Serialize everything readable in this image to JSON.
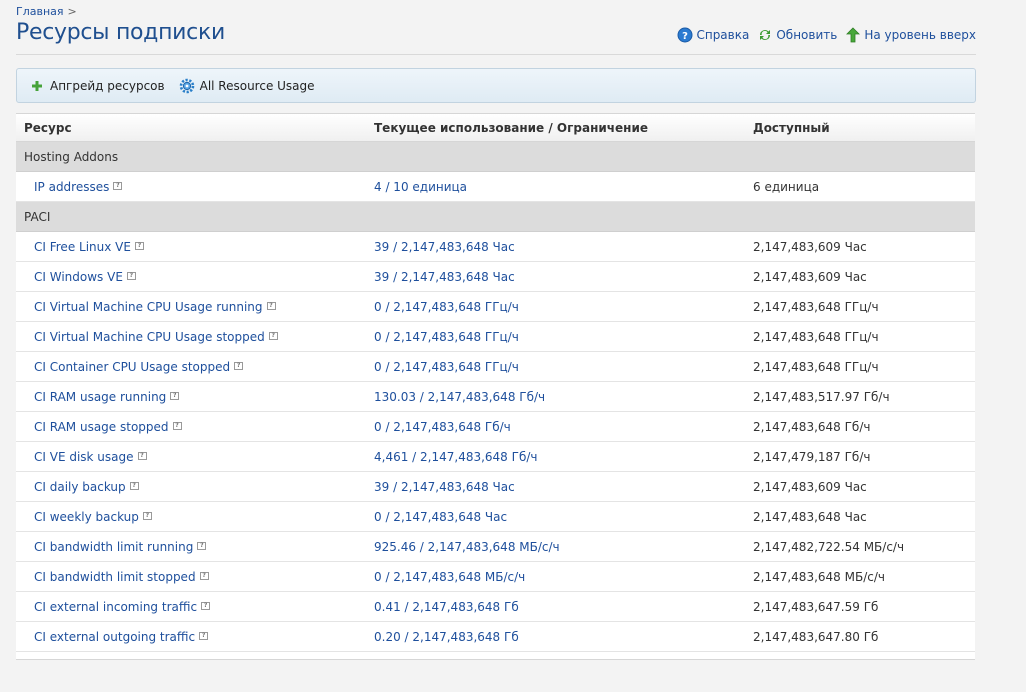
{
  "breadcrumb": {
    "home": "Главная",
    "separator": ">"
  },
  "page": {
    "title": "Ресурсы подписки"
  },
  "actions": {
    "help": "Справка",
    "refresh": "Обновить",
    "up_level": "На уровень вверх"
  },
  "toolbar": {
    "upgrade": "Апгрейд ресурсов",
    "all_usage": "All Resource Usage"
  },
  "table": {
    "headers": {
      "resource": "Ресурс",
      "usage": "Текущее использование / Ограничение",
      "available": "Доступный"
    },
    "groups": [
      {
        "name": "Hosting Addons",
        "rows": [
          {
            "name": "IP addresses",
            "usage": "4 / 10 единица",
            "available": "6 единица"
          }
        ]
      },
      {
        "name": "PACI",
        "rows": [
          {
            "name": "CI Free Linux VE",
            "usage": "39 / 2,147,483,648 Час",
            "available": "2,147,483,609 Час"
          },
          {
            "name": "CI Windows VE",
            "usage": "39 / 2,147,483,648 Час",
            "available": "2,147,483,609 Час"
          },
          {
            "name": "CI Virtual Machine CPU Usage running",
            "usage": "0 / 2,147,483,648 ГГц/ч",
            "available": "2,147,483,648 ГГц/ч"
          },
          {
            "name": "CI Virtual Machine CPU Usage stopped",
            "usage": "0 / 2,147,483,648 ГГц/ч",
            "available": "2,147,483,648 ГГц/ч"
          },
          {
            "name": "CI Container CPU Usage stopped",
            "usage": "0 / 2,147,483,648 ГГц/ч",
            "available": "2,147,483,648 ГГц/ч"
          },
          {
            "name": "CI RAM usage running",
            "usage": "130.03 / 2,147,483,648 Гб/ч",
            "available": "2,147,483,517.97 Гб/ч"
          },
          {
            "name": "CI RAM usage stopped",
            "usage": "0 / 2,147,483,648 Гб/ч",
            "available": "2,147,483,648 Гб/ч"
          },
          {
            "name": "CI VE disk usage",
            "usage": "4,461 / 2,147,483,648 Гб/ч",
            "available": "2,147,479,187 Гб/ч"
          },
          {
            "name": "CI daily backup",
            "usage": "39 / 2,147,483,648 Час",
            "available": "2,147,483,609 Час"
          },
          {
            "name": "CI weekly backup",
            "usage": "0 / 2,147,483,648 Час",
            "available": "2,147,483,648 Час"
          },
          {
            "name": "CI bandwidth limit running",
            "usage": "925.46 / 2,147,483,648 МБ/с/ч",
            "available": "2,147,482,722.54 МБ/с/ч"
          },
          {
            "name": "CI bandwidth limit stopped",
            "usage": "0 / 2,147,483,648 МБ/с/ч",
            "available": "2,147,483,648 МБ/с/ч"
          },
          {
            "name": "CI external incoming traffic",
            "usage": "0.41 / 2,147,483,648 Гб",
            "available": "2,147,483,647.59 Гб"
          },
          {
            "name": "CI external outgoing traffic",
            "usage": "0.20 / 2,147,483,648 Гб",
            "available": "2,147,483,647.80 Гб"
          }
        ]
      }
    ]
  },
  "icons": {
    "help": "help-icon",
    "refresh": "refresh-icon",
    "up_level": "up-arrow-icon",
    "upgrade": "plus-icon",
    "all_usage": "gear-icon",
    "hint": "hint-icon"
  },
  "colors": {
    "link": "#1e4f9c",
    "title": "#1f4f8f",
    "group_bg": "#dcdcdc",
    "toolbar_bg": "#e6eff6"
  }
}
